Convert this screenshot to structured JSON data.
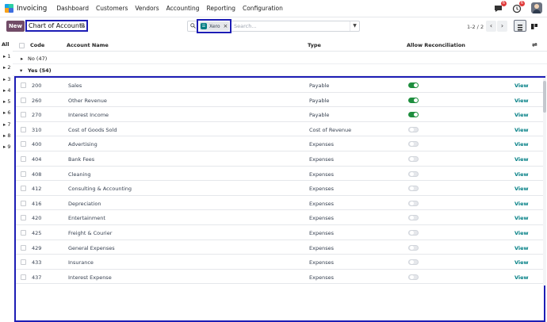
{
  "topbar": {
    "app_name": "Invoicing",
    "menu": [
      "Dashboard",
      "Customers",
      "Vendors",
      "Accounting",
      "Reporting",
      "Configuration"
    ],
    "chat_badge": "6",
    "activity_badge": "6"
  },
  "control": {
    "new_label": "New",
    "breadcrumb": "Chart of Accounts",
    "search_facet": "Xero",
    "search_placeholder": "Search...",
    "pager": "1-2 / 2"
  },
  "groupbar": {
    "all_label": "All",
    "groups": [
      "1",
      "2",
      "3",
      "4",
      "5",
      "6",
      "7",
      "8",
      "9"
    ]
  },
  "list": {
    "headers": {
      "code": "Code",
      "name": "Account Name",
      "type": "Type",
      "reconcile": "Allow Reconciliation"
    },
    "group_no": "No (47)",
    "group_yes": "Yes (54)",
    "view_label": "View",
    "rows": [
      {
        "code": "200",
        "name": "Sales",
        "type": "Payable",
        "reconcile": true
      },
      {
        "code": "260",
        "name": "Other Revenue",
        "type": "Payable",
        "reconcile": true
      },
      {
        "code": "270",
        "name": "Interest Income",
        "type": "Payable",
        "reconcile": true
      },
      {
        "code": "310",
        "name": "Cost of Goods Sold",
        "type": "Cost of Revenue",
        "reconcile": false
      },
      {
        "code": "400",
        "name": "Advertising",
        "type": "Expenses",
        "reconcile": false
      },
      {
        "code": "404",
        "name": "Bank Fees",
        "type": "Expenses",
        "reconcile": false
      },
      {
        "code": "408",
        "name": "Cleaning",
        "type": "Expenses",
        "reconcile": false
      },
      {
        "code": "412",
        "name": "Consulting & Accounting",
        "type": "Expenses",
        "reconcile": false
      },
      {
        "code": "416",
        "name": "Depreciation",
        "type": "Expenses",
        "reconcile": false
      },
      {
        "code": "420",
        "name": "Entertainment",
        "type": "Expenses",
        "reconcile": false
      },
      {
        "code": "425",
        "name": "Freight & Courier",
        "type": "Expenses",
        "reconcile": false
      },
      {
        "code": "429",
        "name": "General Expenses",
        "type": "Expenses",
        "reconcile": false
      },
      {
        "code": "433",
        "name": "Insurance",
        "type": "Expenses",
        "reconcile": false
      },
      {
        "code": "437",
        "name": "Interest Expense",
        "type": "Expenses",
        "reconcile": false
      }
    ]
  },
  "colors": {
    "brand": "#714b67",
    "accent": "#017e84",
    "toggle_on": "#1e8e3e",
    "highlight": "#1d1db5"
  }
}
